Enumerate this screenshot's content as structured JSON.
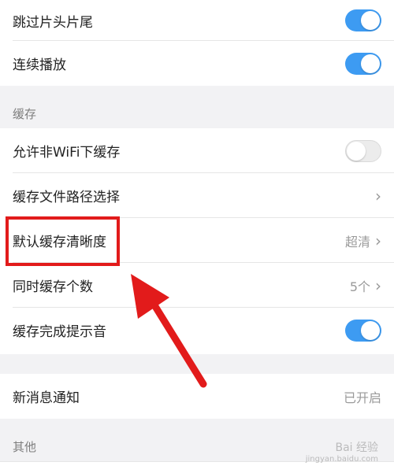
{
  "playback": {
    "rows": [
      {
        "label": "跳过片头片尾",
        "toggle": "on"
      },
      {
        "label": "连续播放",
        "toggle": "on"
      }
    ]
  },
  "cache": {
    "header": "缓存",
    "wifi_only": {
      "label": "允许非WiFi下缓存",
      "toggle": "off"
    },
    "path": {
      "label": "缓存文件路径选择"
    },
    "quality": {
      "label": "默认缓存清晰度",
      "value": "超清"
    },
    "concurrent": {
      "label": "同时缓存个数",
      "value": "5个"
    },
    "sound": {
      "label": "缓存完成提示音",
      "toggle": "on"
    }
  },
  "notification": {
    "row": {
      "label": "新消息通知",
      "value": "已开启"
    }
  },
  "other": {
    "header": "其他"
  },
  "icons": {
    "chevron": "chevron-right-icon"
  },
  "colors": {
    "toggle_on": "#3d9bf2",
    "annotation": "#e21b1b"
  },
  "watermark": {
    "main": "Bai 经验",
    "sub": "jingyan.baidu.com"
  }
}
